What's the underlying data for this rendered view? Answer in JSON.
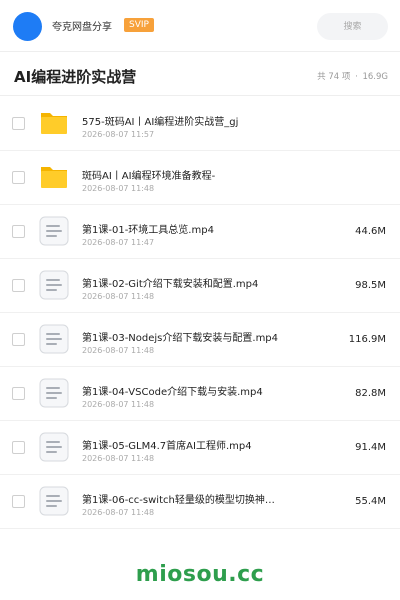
{
  "header": {
    "site_name": "夸克网盘分享",
    "badge": "SVIP",
    "search_placeholder": "搜索",
    "brand_color": "#1e7cf5",
    "badge_color": "#f7a13a"
  },
  "title_bar": {
    "title": "AI编程进阶实战营",
    "count": "共 74 项",
    "separator": "·",
    "total_size": "16.9G"
  },
  "files": [
    {
      "type": "folder",
      "icon": "folder-icon",
      "name": "575-斑码AI丨AI编程进阶实战营_gj",
      "date": "2026-08-07 11:57",
      "size": ""
    },
    {
      "type": "folder",
      "icon": "folder-icon",
      "name": "斑码AI丨AI编程环境准备教程-",
      "date": "2026-08-07 11:48",
      "size": ""
    },
    {
      "type": "file",
      "icon": "document-icon",
      "name": "第1课-01-环境工具总览.mp4",
      "date": "2026-08-07 11:47",
      "size": "44.6M"
    },
    {
      "type": "file",
      "icon": "document-icon",
      "name": "第1课-02-Git介绍下载安装和配置.mp4",
      "date": "2026-08-07 11:48",
      "size": "98.5M"
    },
    {
      "type": "file",
      "icon": "document-icon",
      "name": "第1课-03-Nodejs介绍下载安装与配置.mp4",
      "date": "2026-08-07 11:48",
      "size": "116.9M"
    },
    {
      "type": "file",
      "icon": "document-icon",
      "name": "第1课-04-VSCode介绍下载与安装.mp4",
      "date": "2026-08-07 11:48",
      "size": "82.8M"
    },
    {
      "type": "file",
      "icon": "document-icon",
      "name": "第1课-05-GLM4.7首席AI工程师.mp4",
      "date": "2026-08-07 11:48",
      "size": "91.4M"
    },
    {
      "type": "file",
      "icon": "document-icon",
      "name": "第1课-06-cc-switch轻量级的模型切换神…",
      "date": "2026-08-07 11:48",
      "size": "55.4M"
    }
  ],
  "footer": {
    "watermark": "miosou.cc",
    "watermark_color": "#2e9e4d"
  }
}
